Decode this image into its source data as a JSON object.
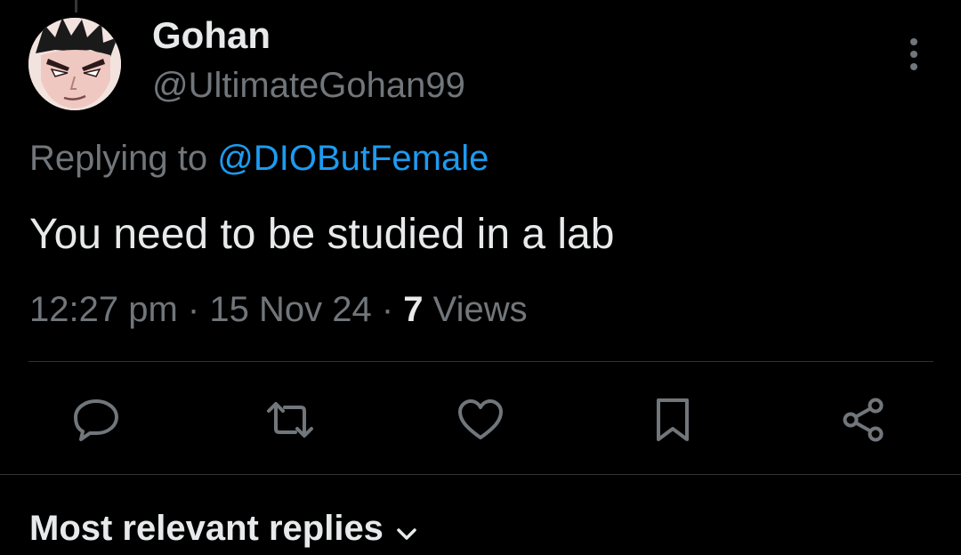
{
  "tweet": {
    "author": {
      "display_name": "Gohan",
      "handle": "@UltimateGohan99",
      "avatar_alt": "avatar"
    },
    "reply_context": {
      "prefix": "Replying to ",
      "mention": "@DIOButFemale"
    },
    "text": "You need to be studied in a lab",
    "meta": {
      "time": "12:27 pm",
      "separator": "·",
      "date": "15 Nov 24",
      "views_count": "7",
      "views_label": "Views"
    }
  },
  "actions": {
    "reply": "reply-icon",
    "repost": "repost-icon",
    "like": "heart-icon",
    "bookmark": "bookmark-icon",
    "share": "share-icon"
  },
  "replies_section": {
    "title": "Most relevant replies"
  },
  "colors": {
    "background": "#000000",
    "primary_text": "#e7e9ea",
    "secondary_text": "#71767b",
    "accent": "#1d9bf0",
    "divider": "#2f3336"
  }
}
